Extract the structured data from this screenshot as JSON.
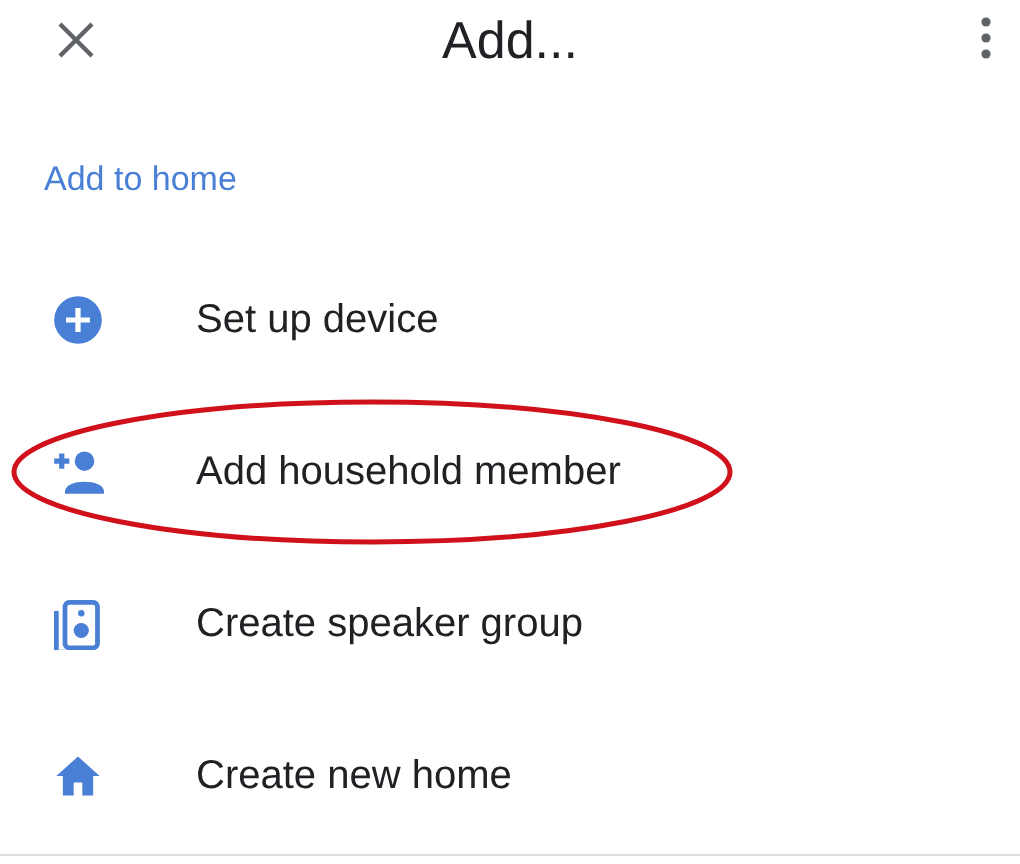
{
  "top_bar": {
    "title": "Add..."
  },
  "section": {
    "heading": "Add to home"
  },
  "items": [
    {
      "label": "Set up device",
      "kind": "device",
      "highlighted": false
    },
    {
      "label": "Add household member",
      "kind": "member",
      "highlighted": true
    },
    {
      "label": "Create speaker group",
      "kind": "speaker",
      "highlighted": false
    },
    {
      "label": "Create new home",
      "kind": "home",
      "highlighted": false
    }
  ]
}
